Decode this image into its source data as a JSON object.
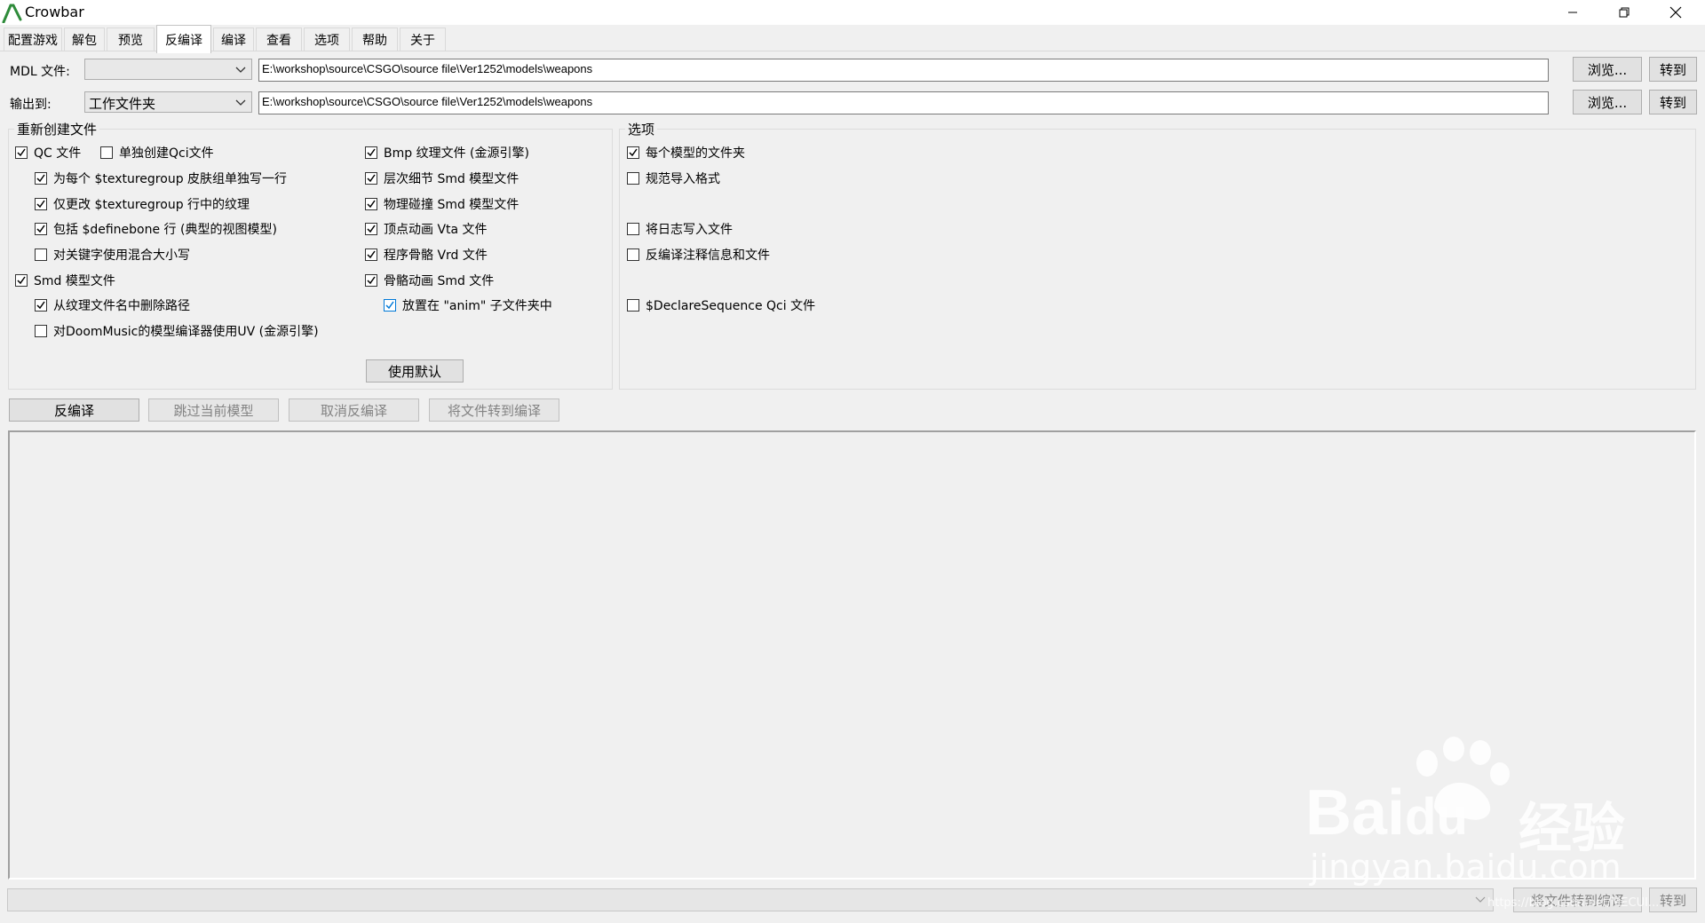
{
  "window": {
    "title": "Crowbar"
  },
  "tabs": [
    {
      "label": "配置游戏"
    },
    {
      "label": "解包"
    },
    {
      "label": "预览"
    },
    {
      "label": "反编译"
    },
    {
      "label": "编译"
    },
    {
      "label": "查看"
    },
    {
      "label": "选项"
    },
    {
      "label": "帮助"
    },
    {
      "label": "关于"
    }
  ],
  "mdl_row": {
    "label": "MDL 文件:",
    "combo_value": "",
    "path": "E:\\workshop\\source\\CSGO\\source file\\Ver1252\\models\\weapons",
    "browse_label": "浏览...",
    "goto_label": "转到"
  },
  "output_row": {
    "label": "输出到:",
    "combo_value": "工作文件夹",
    "path": "E:\\workshop\\source\\CSGO\\source file\\Ver1252\\models\\weapons",
    "browse_label": "浏览...",
    "goto_label": "转到"
  },
  "recreate_group": {
    "title": "重新创建文件",
    "col1": [
      {
        "label": "QC 文件",
        "checked": true
      },
      {
        "label": "单独创建Qci文件",
        "checked": false
      },
      {
        "label": "为每个 $texturegroup 皮肤组单独写一行",
        "checked": true
      },
      {
        "label": "仅更改 $texturegroup 行中的纹理",
        "checked": true
      },
      {
        "label": "包括 $definebone 行 (典型的视图模型)",
        "checked": true
      },
      {
        "label": "对关键字使用混合大小写",
        "checked": false
      },
      {
        "label": "Smd 模型文件",
        "checked": true
      },
      {
        "label": "从纹理文件名中删除路径",
        "checked": true
      },
      {
        "label": "对DoomMusic的模型编译器使用UV (金源引擎)",
        "checked": false
      }
    ],
    "col2": [
      {
        "label": "Bmp 纹理文件 (金源引擎)",
        "checked": true
      },
      {
        "label": "层次细节 Smd 模型文件",
        "checked": true
      },
      {
        "label": "物理碰撞 Smd 模型文件",
        "checked": true
      },
      {
        "label": "顶点动画 Vta 文件",
        "checked": true
      },
      {
        "label": "程序骨骼 Vrd 文件",
        "checked": true
      },
      {
        "label": "骨骼动画 Smd 文件",
        "checked": true
      },
      {
        "label": "放置在 \"anim\" 子文件夹中",
        "checked": true
      }
    ],
    "default_button": "使用默认"
  },
  "options_group": {
    "title": "选项",
    "items": [
      {
        "label": "每个模型的文件夹",
        "checked": true
      },
      {
        "label": "规范导入格式",
        "checked": false
      },
      {
        "label": "将日志写入文件",
        "checked": false
      },
      {
        "label": "反编译注释信息和文件",
        "checked": false
      },
      {
        "label": "$DeclareSequence Qci 文件",
        "checked": false
      }
    ]
  },
  "actions": {
    "decompile": "反编译",
    "skip": "跳过当前模型",
    "cancel": "取消反编译",
    "send_to_compile": "将文件转到编译"
  },
  "bottom": {
    "send_to_compile": "将文件转到编译",
    "goto": "转到"
  },
  "watermark": {
    "brand_left": "Bai",
    "brand_mid": "du",
    "brand_cn": "经验",
    "site": "jingyan.baidu.com",
    "url": "https://blog.csdn.net/MECUI..."
  },
  "colors": {
    "accent": "#0078d7",
    "icon_green": "#2e7d32"
  }
}
